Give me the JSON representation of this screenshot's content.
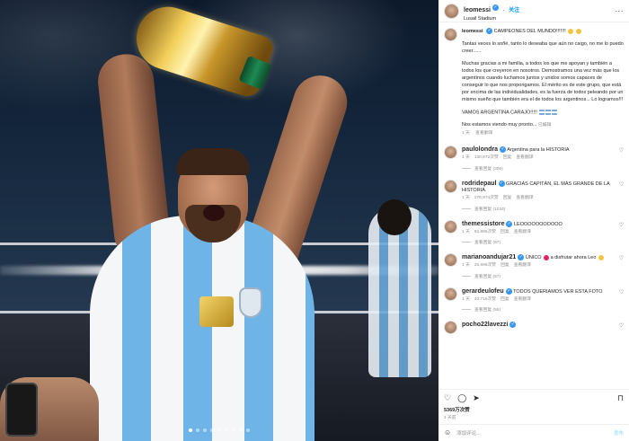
{
  "post": {
    "username": "leomessi",
    "follow_label": "关注",
    "location": "Lusail Stadium",
    "more_label": "···",
    "carousel_dots": 9,
    "carousel_active": 0
  },
  "caption": {
    "username": "leomessi",
    "headline": "CAMPEONES DEL MUNDO!!!!!!!",
    "p1": "Tantas veces lo soñé, tanto lo deseaba que aún no caigo, no me lo puedo creer......",
    "p2": "Muchas gracias a mi familia, a todos los que me apoyan y también a todos los que creyeron en nosotros. Demostramos una vez más que los argentinos cuando luchamos juntos y unidos somos capaces de conseguir lo que nos propongamos. El mérito es de este grupo, que está por encima de las individualidades, es la fuerza de todos peleando por un mismo sueño que también era el de todos los argentinos... Lo logramos!!!",
    "p3": "VAMOS ARGENTINA CARAJO!!!!!",
    "p4": "Nos estamos viendo muy pronto...",
    "edited": "已编辑",
    "time": "1 天",
    "translate": "查看翻译"
  },
  "comments": [
    {
      "user": "paulolondra",
      "text": "Argentina para la HISTORIA",
      "time": "1 天",
      "likes": "130,972次赞",
      "reply": "回复",
      "translate": "查看翻译",
      "replies": "查看回复 (306)"
    },
    {
      "user": "rodridepaul",
      "text": "GRACIAS CAPITÁN, EL MÁS GRANDE DE LA HISTORIA.",
      "time": "1 天",
      "likes": "276,974次赞",
      "reply": "回复",
      "translate": "查看翻译",
      "replies": "查看回复 (1034)"
    },
    {
      "user": "themessistore",
      "text": "LEOOOOOOOOOOO",
      "time": "1 天",
      "likes": "62,896次赞",
      "reply": "回复",
      "translate": "查看翻译",
      "replies": "查看回复 (67)"
    },
    {
      "user": "marianoandujar21",
      "text": "ÚNICO",
      "text2": "a disfrutar ahora Leo",
      "time": "1 天",
      "likes": "25,696次赞",
      "reply": "回复",
      "translate": "查看翻译",
      "replies": "查看回复 (57)"
    },
    {
      "user": "gerardeulofeu",
      "text": "TODOS QUERIAMOS VER ESTA FOTO",
      "time": "1 天",
      "likes": "40,716次赞",
      "reply": "回复",
      "translate": "查看翻译",
      "replies": "查看回复 (55)"
    },
    {
      "user": "pocho22lavezzi",
      "text": ""
    }
  ],
  "actions": {
    "likes": "5369万次赞",
    "date": "1 天前"
  },
  "add_comment": {
    "placeholder": "添加评论...",
    "post_label": "发布"
  }
}
